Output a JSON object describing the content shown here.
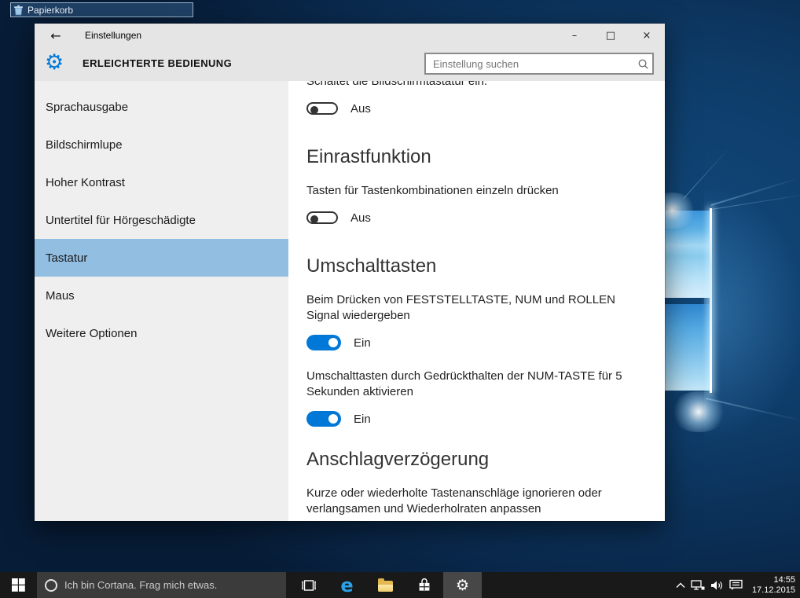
{
  "desktop": {
    "recycle_bin_label": "Papierkorb"
  },
  "icons": {
    "back": "←",
    "gear": "⚙",
    "minimize": "–",
    "maximize": "□",
    "close": "×"
  },
  "settings_window": {
    "title": "Einstellungen",
    "header": {
      "app_title": "ERLEICHTERTE BEDIENUNG",
      "search_placeholder": "Einstellung suchen"
    },
    "sidebar": {
      "items": [
        {
          "label": "Sprachausgabe",
          "selected": false
        },
        {
          "label": "Bildschirmlupe",
          "selected": false
        },
        {
          "label": "Hoher Kontrast",
          "selected": false
        },
        {
          "label": "Untertitel für Hörgeschädigte",
          "selected": false
        },
        {
          "label": "Tastatur",
          "selected": true
        },
        {
          "label": "Maus",
          "selected": false
        },
        {
          "label": "Weitere Optionen",
          "selected": false
        }
      ]
    },
    "content": {
      "blocks": [
        {
          "type": "setting",
          "text": "Schaltet die Bildschirmtastatur ein.",
          "toggle": "off",
          "state": "Aus"
        },
        {
          "type": "heading",
          "text": "Einrastfunktion"
        },
        {
          "type": "setting",
          "text": "Tasten für Tastenkombinationen einzeln drücken",
          "toggle": "off",
          "state": "Aus"
        },
        {
          "type": "heading",
          "text": "Umschalttasten"
        },
        {
          "type": "setting",
          "text": "Beim Drücken von FESTSTELLTASTE, NUM und ROLLEN Signal wiedergeben",
          "toggle": "on",
          "state": "Ein"
        },
        {
          "type": "setting",
          "text": "Umschalttasten durch Gedrückthalten der NUM-TASTE für 5 Sekunden aktivieren",
          "toggle": "on",
          "state": "Ein"
        },
        {
          "type": "heading",
          "text": "Anschlagverzögerung"
        },
        {
          "type": "text",
          "text": "Kurze oder wiederholte Tastenanschläge ignorieren oder verlangsamen und Wiederholraten anpassen"
        }
      ]
    }
  },
  "taskbar": {
    "cortana_placeholder": "Ich bin Cortana. Frag mich etwas.",
    "clock": {
      "time": "14:55",
      "date": "17.12.2015"
    }
  },
  "colors": {
    "accent": "#0078d7",
    "sidebar_selected": "#92bee2",
    "header_bg": "#e5e5e5",
    "taskbar_bg": "#191919"
  }
}
